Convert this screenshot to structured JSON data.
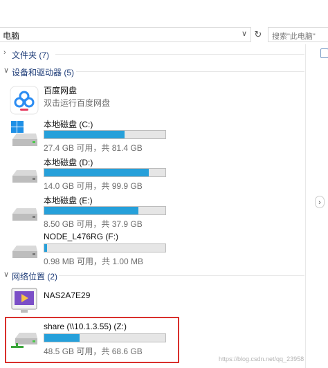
{
  "address_bar": {
    "path_text": "电脑",
    "search_placeholder": "搜索\"此电脑\""
  },
  "sections": {
    "folders": {
      "label": "文件夹 (7)",
      "expanded": false
    },
    "devices": {
      "label": "设备和驱动器 (5)",
      "expanded": true
    },
    "network": {
      "label": "网络位置 (2)",
      "expanded": true
    }
  },
  "devices": [
    {
      "name": "百度网盘",
      "subtitle": "双击运行百度网盘",
      "icon": "baidu-netdisk-icon"
    },
    {
      "name": "本地磁盘 (C:)",
      "sizes": "27.4 GB 可用，共 81.4 GB",
      "used_fraction": 0.663,
      "icon": "windows-drive-icon"
    },
    {
      "name": "本地磁盘 (D:)",
      "sizes": "14.0 GB 可用，共 99.9 GB",
      "used_fraction": 0.86,
      "icon": "drive-icon"
    },
    {
      "name": "本地磁盘 (E:)",
      "sizes": "8.50 GB 可用，共 37.9 GB",
      "used_fraction": 0.776,
      "icon": "drive-icon"
    },
    {
      "name": "NODE_L476RG (F:)",
      "sizes": "0.98 MB 可用，共 1.00 MB",
      "used_fraction": 0.02,
      "icon": "drive-icon"
    }
  ],
  "network": [
    {
      "name": "NAS2A7E29",
      "icon": "media-server-icon"
    },
    {
      "name": "share (\\\\10.1.3.55) (Z:)",
      "sizes": "48.5 GB 可用，共 68.6 GB",
      "used_fraction": 0.293,
      "icon": "network-drive-icon"
    }
  ],
  "watermark": "https://blog.csdn.net/qq_23958"
}
